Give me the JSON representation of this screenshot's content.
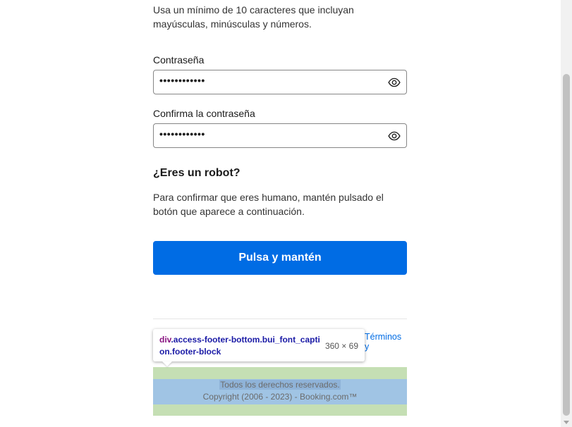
{
  "form": {
    "password_hint": "Usa un mínimo de 10 caracteres que incluyan mayúsculas, minúsculas y números.",
    "password_label": "Contraseña",
    "password_value": "••••••••••••",
    "confirm_label": "Confirma la contraseña",
    "confirm_value": "••••••••••••"
  },
  "robot": {
    "title": "¿Eres un robot?",
    "description": "Para confirmar que eres humano, mantén pulsado el botón que aparece a continuación.",
    "button_label": "Pulsa y mantén"
  },
  "footer": {
    "terms_link": "Términos y",
    "rights": "Todos los derechos reservados.",
    "copyright": "Copyright (2006 - 2023) - Booking.com™"
  },
  "devtools_tooltip": {
    "tag": "div",
    "selector": ".access-footer-bottom.bui_font_caption.footer-block",
    "dimensions": "360 × 69"
  },
  "colors": {
    "primary_button": "#006ce4",
    "footer_margin_highlight": "#c5dfb4",
    "footer_content_highlight": "#a0c4e4"
  },
  "icons": {
    "password_toggle": "eye-icon",
    "confirm_toggle": "eye-icon"
  }
}
